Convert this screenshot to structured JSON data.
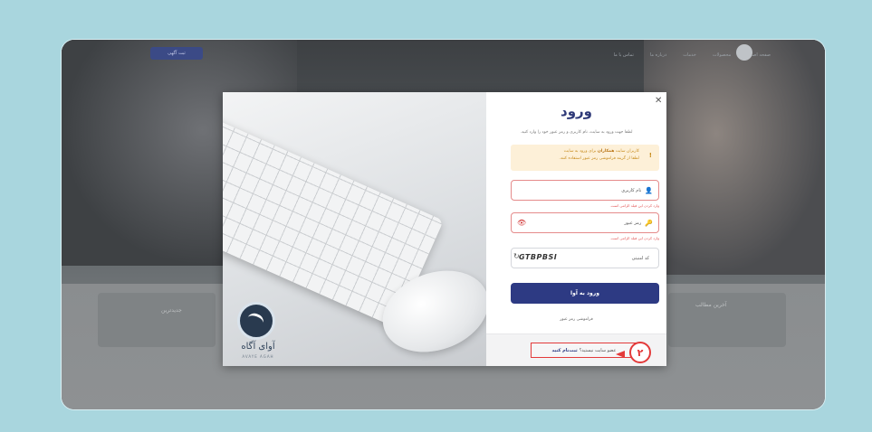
{
  "site": {
    "nav_button": "ثبت آگهی",
    "nav_items": [
      "صفحه اصلی",
      "محصولات",
      "خدمات",
      "درباره ما",
      "تماس با ما"
    ],
    "section_left": "جدیدترین",
    "section_right": "آخرین مطالب"
  },
  "modal": {
    "close_icon": "✕",
    "title": "ورود",
    "description": "لطفا جهت ورود به سایت، نام کاربری و رمز عبور خود را وارد کنید.",
    "alert": {
      "icon": "!",
      "line1_prefix": "کاربران سایت",
      "line1_bold": "همکاران",
      "line1_suffix": "برای ورود به سایت",
      "line2": "لطفا از گزینه فراموشی رمز عبور استفاده کنند."
    },
    "username": {
      "icon": "👤",
      "label": "نام کاربری",
      "hint": "وارد کردن این فیلد الزامی است."
    },
    "password": {
      "icon": "🔑",
      "label": "رمز عبور",
      "eye_icon": "👁",
      "hint": "وارد کردن این فیلد الزامی است."
    },
    "captcha": {
      "label": "کد امنیتی",
      "code": "GTBPBSI",
      "refresh_icon": "↻"
    },
    "submit_label": "ورود به آوا",
    "forgot_label": "فراموشی رمز عبور",
    "register": {
      "question": "عضو سایت نیستید؟",
      "link": "ثبت‌نام کنید"
    },
    "brand": {
      "name": "آوای آگاه",
      "sub": "AVAYE AGAH"
    }
  },
  "annotation": {
    "step_number": "۲",
    "color": "#e33a3a"
  }
}
